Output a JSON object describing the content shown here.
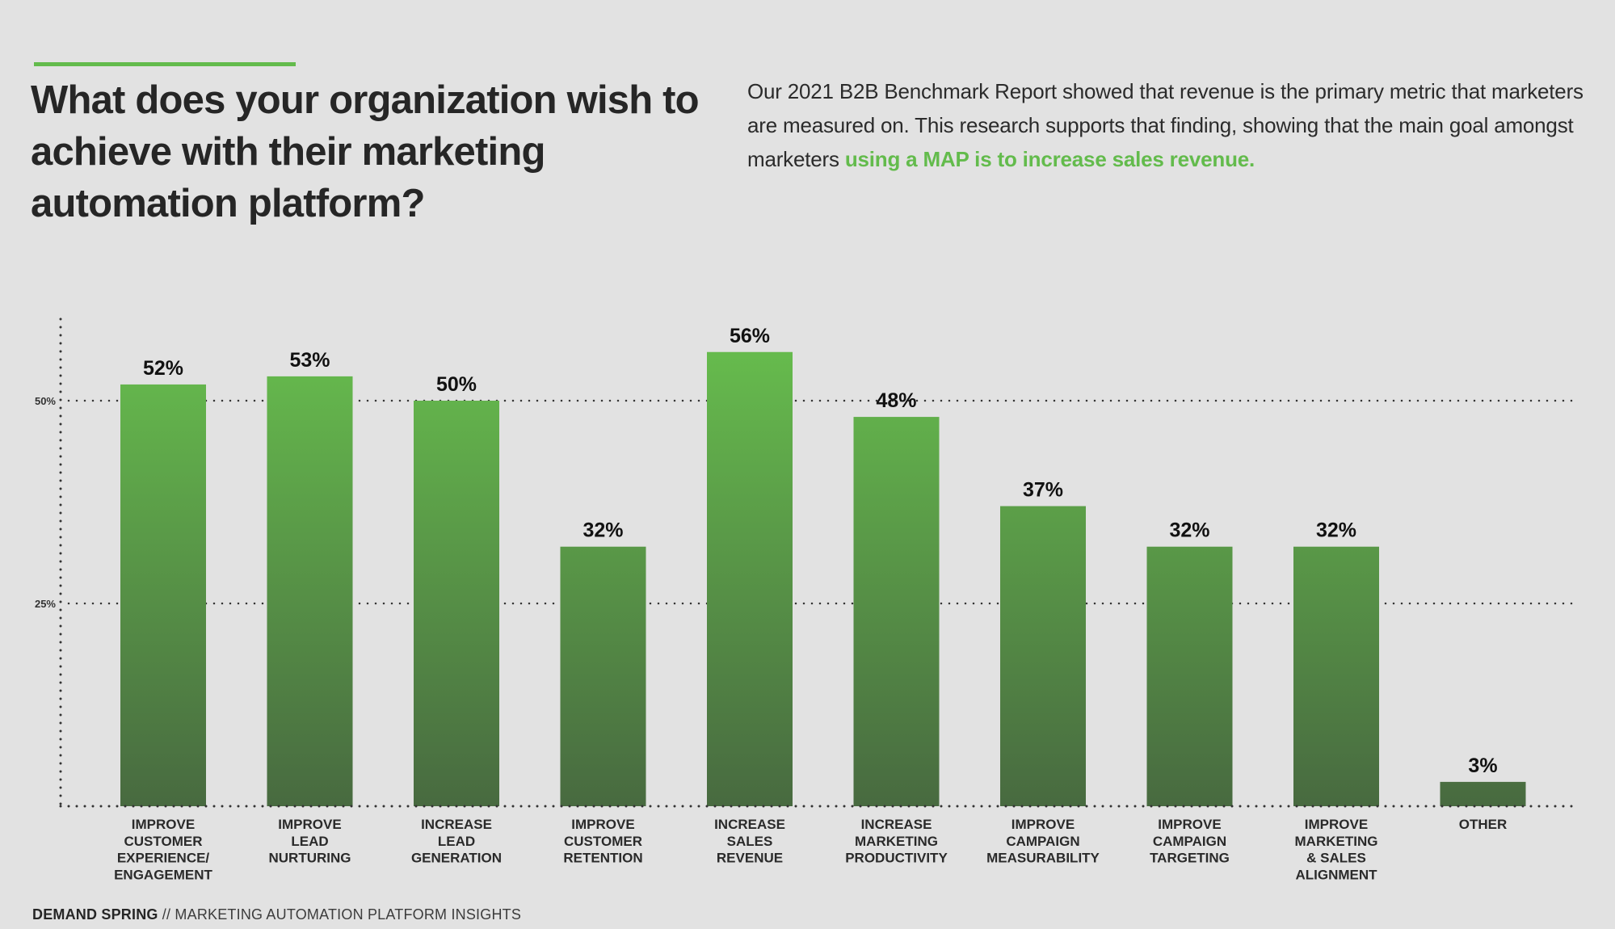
{
  "header": {
    "title": "What does your organization wish to achieve with their marketing automation platform?",
    "intro_text": "Our 2021 B2B Benchmark Report showed that revenue is the primary metric that marketers are measured on. This research supports that finding, showing that the main goal amongst marketers ",
    "intro_highlight": "using a MAP is to increase sales revenue."
  },
  "colors": {
    "accent": "#63bb4c",
    "bar_top": "#66bb4d",
    "bar_bottom": "#486a40",
    "text": "#262626",
    "background": "#e2e2e2"
  },
  "chart_data": {
    "type": "bar",
    "title": "What does your organization wish to achieve with their marketing automation platform?",
    "xlabel": "",
    "ylabel": "",
    "ylim": [
      0,
      60
    ],
    "yticks": [
      25,
      50
    ],
    "ytick_labels": [
      "25%",
      "50%"
    ],
    "grid": true,
    "legend": "none",
    "categories": [
      [
        "IMPROVE",
        "CUSTOMER",
        "EXPERIENCE/",
        "ENGAGEMENT"
      ],
      [
        "IMPROVE",
        "LEAD",
        "NURTURING"
      ],
      [
        "INCREASE",
        "LEAD",
        "GENERATION"
      ],
      [
        "IMPROVE",
        "CUSTOMER",
        "RETENTION"
      ],
      [
        "INCREASE",
        "SALES",
        "REVENUE"
      ],
      [
        "INCREASE",
        "MARKETING",
        "PRODUCTIVITY"
      ],
      [
        "IMPROVE",
        "CAMPAIGN",
        "MEASURABILITY"
      ],
      [
        "IMPROVE",
        "CAMPAIGN",
        "TARGETING"
      ],
      [
        "IMPROVE",
        "MARKETING",
        "& SALES",
        "ALIGNMENT"
      ],
      [
        "OTHER"
      ]
    ],
    "values": [
      52,
      53,
      50,
      32,
      56,
      48,
      37,
      32,
      32,
      3
    ],
    "value_labels": [
      "52%",
      "53%",
      "50%",
      "32%",
      "56%",
      "48%",
      "37%",
      "32%",
      "32%",
      "3%"
    ]
  },
  "footer": {
    "brand": "DEMAND SPRING",
    "separator": " // ",
    "subtitle": "MARKETING AUTOMATION PLATFORM INSIGHTS"
  }
}
